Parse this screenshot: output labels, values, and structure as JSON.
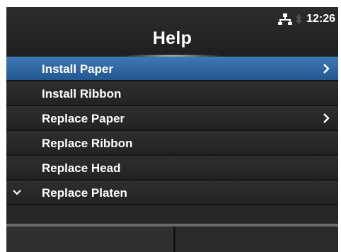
{
  "header": {
    "title": "Help",
    "time": "12:26",
    "network_icon": "network-icon",
    "bluetooth_icon": "bluetooth-icon"
  },
  "menu": {
    "items": [
      {
        "label": "Install Paper",
        "selected": true,
        "has_submenu": true
      },
      {
        "label": "Install Ribbon",
        "selected": false,
        "has_submenu": false
      },
      {
        "label": "Replace Paper",
        "selected": false,
        "has_submenu": true
      },
      {
        "label": "Replace Ribbon",
        "selected": false,
        "has_submenu": false
      },
      {
        "label": "Replace Head",
        "selected": false,
        "has_submenu": false
      },
      {
        "label": "Replace Platen",
        "selected": false,
        "has_submenu": false,
        "scroll_down_indicator": true
      }
    ]
  },
  "colors": {
    "background": "#262626",
    "selected": "#2f68a6",
    "text": "#ffffff"
  }
}
